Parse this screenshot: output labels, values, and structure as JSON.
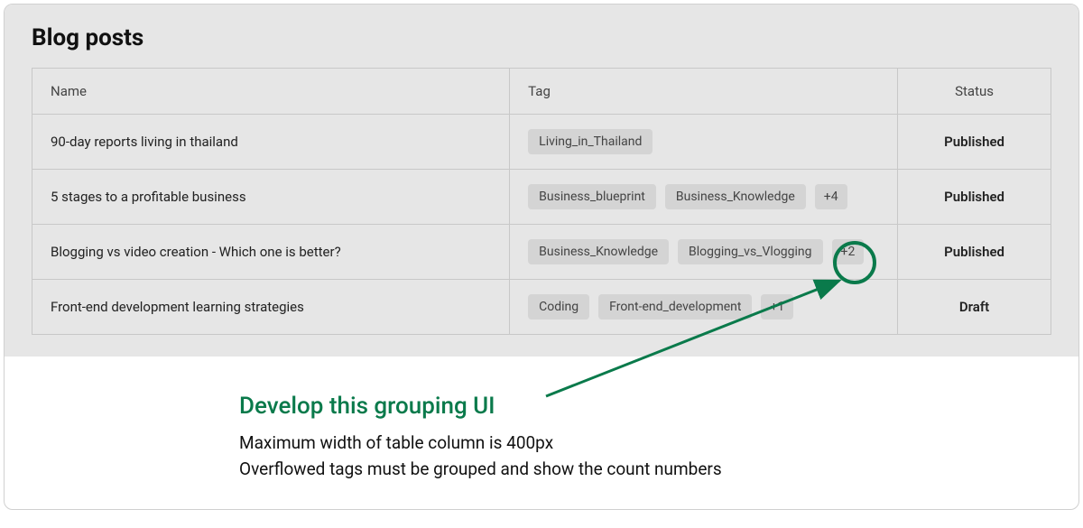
{
  "title": "Blog posts",
  "columns": {
    "name": "Name",
    "tag": "Tag",
    "status": "Status"
  },
  "rows": [
    {
      "name": "90-day reports living in thailand",
      "tags": [
        "Living_in_Thailand"
      ],
      "overflow": null,
      "status": "Published"
    },
    {
      "name": "5 stages to a profitable business",
      "tags": [
        "Business_blueprint",
        "Business_Knowledge"
      ],
      "overflow": "+4",
      "status": "Published"
    },
    {
      "name": "Blogging vs video creation - Which one is better?",
      "tags": [
        "Business_Knowledge",
        "Blogging_vs_Vlogging"
      ],
      "overflow": "+2",
      "status": "Published"
    },
    {
      "name": "Front-end development learning strategies",
      "tags": [
        "Coding",
        "Front-end_development"
      ],
      "overflow": "+1",
      "status": "Draft"
    }
  ],
  "annotation": {
    "headline": "Develop this grouping UI",
    "line1": "Maximum width of table column is 400px",
    "line2": "Overflowed tags must be grouped and show the count numbers"
  }
}
